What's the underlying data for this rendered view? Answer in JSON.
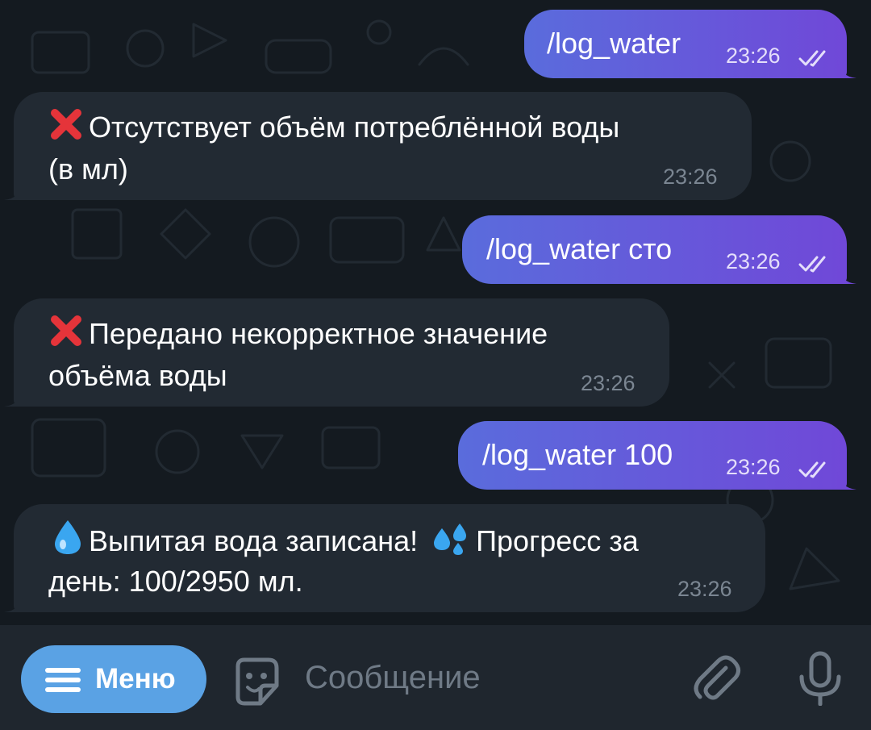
{
  "messages": [
    {
      "type": "out",
      "text": "/log_water",
      "time": "23:26",
      "status_icon": "double-check-icon"
    },
    {
      "type": "in",
      "icon": "cross-mark-emoji",
      "lines": [
        "Отсутствует объём потреблённой воды",
        "(в мл)"
      ],
      "time": "23:26"
    },
    {
      "type": "out",
      "text": "/log_water сто",
      "time": "23:26",
      "status_icon": "double-check-icon"
    },
    {
      "type": "in",
      "icon": "cross-mark-emoji",
      "lines": [
        "Передано некорректное значение",
        "объёма воды"
      ],
      "time": "23:26"
    },
    {
      "type": "out",
      "text": "/log_water 100",
      "time": "23:26",
      "status_icon": "double-check-icon"
    },
    {
      "type": "in",
      "icons": [
        "droplet-emoji",
        "sweat-droplets-emoji"
      ],
      "line1_a": "Выпитая вода записана!",
      "line1_b": "Прогресс за",
      "line2": "день: 100/2950 мл.",
      "time": "23:26"
    }
  ],
  "input_bar": {
    "menu_label": "Меню",
    "placeholder": "Сообщение",
    "icons": [
      "menu-icon",
      "sticker-icon",
      "attach-icon",
      "mic-icon"
    ]
  },
  "colors": {
    "outgoing_start": "#5a6cdc",
    "outgoing_end": "#7048d8",
    "incoming": "#222a33",
    "background": "#141a20",
    "menu_button": "#5aa2e4"
  }
}
